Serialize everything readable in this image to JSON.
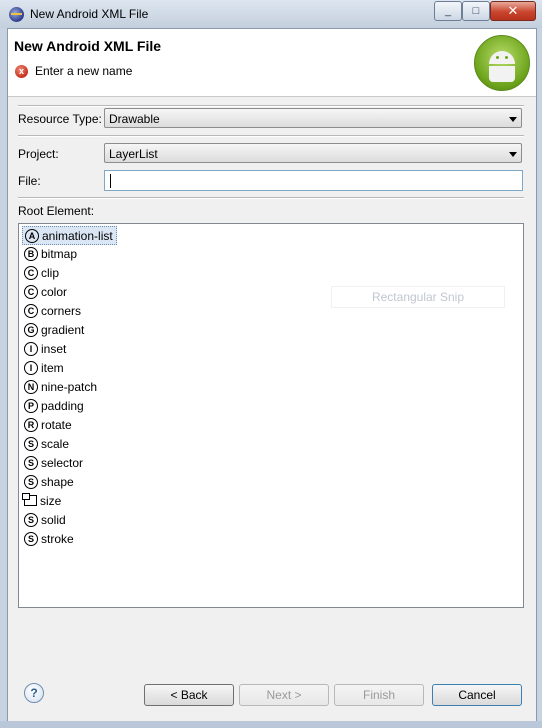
{
  "window": {
    "title": "New Android XML File",
    "minimize_glyph": "_",
    "maximize_glyph": "□",
    "close_glyph": "✕"
  },
  "banner": {
    "title": "New Android XML File",
    "message": "Enter a new name",
    "error_icon_glyph": "x"
  },
  "form": {
    "resource_type_label": "Resource Type:",
    "resource_type_value": "Drawable",
    "project_label": "Project:",
    "project_value": "LayerList",
    "file_label": "File:",
    "file_value": "",
    "root_element_label": "Root Element:"
  },
  "root_elements": [
    {
      "glyph": "A",
      "name": "animation-list",
      "selected": true
    },
    {
      "glyph": "B",
      "name": "bitmap"
    },
    {
      "glyph": "C",
      "name": "clip"
    },
    {
      "glyph": "C",
      "name": "color"
    },
    {
      "glyph": "C",
      "name": "corners"
    },
    {
      "glyph": "G",
      "name": "gradient"
    },
    {
      "glyph": "I",
      "name": "inset"
    },
    {
      "glyph": "I",
      "name": "item"
    },
    {
      "glyph": "N",
      "name": "nine-patch"
    },
    {
      "glyph": "P",
      "name": "padding"
    },
    {
      "glyph": "R",
      "name": "rotate"
    },
    {
      "glyph": "S",
      "name": "scale"
    },
    {
      "glyph": "S",
      "name": "selector"
    },
    {
      "glyph": "S",
      "name": "shape"
    },
    {
      "glyph": "",
      "name": "size",
      "box": true
    },
    {
      "glyph": "S",
      "name": "solid"
    },
    {
      "glyph": "S",
      "name": "stroke"
    }
  ],
  "ghost_overlay": "Rectangular Snip",
  "buttons": {
    "help_glyph": "?",
    "back": "< Back",
    "next": "Next >",
    "finish": "Finish",
    "cancel": "Cancel"
  }
}
